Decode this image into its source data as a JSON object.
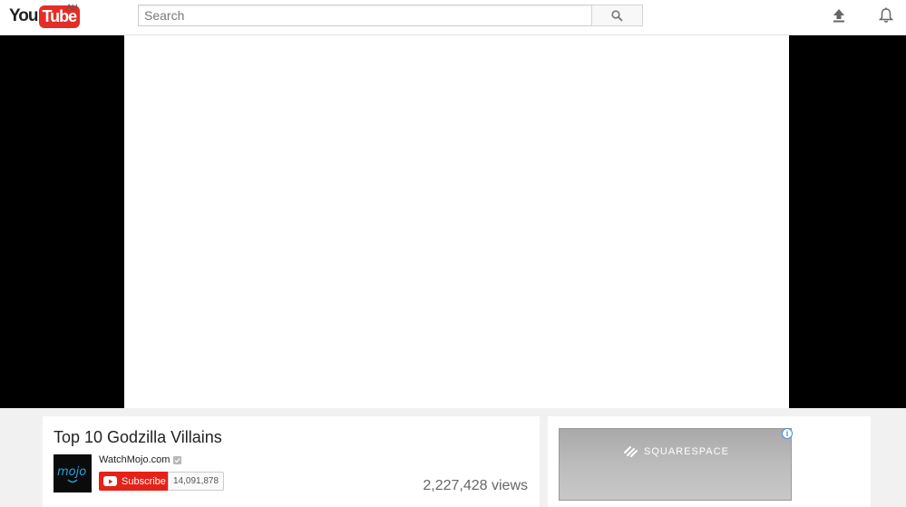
{
  "masthead": {
    "logo_you": "You",
    "logo_tube": "Tube",
    "region": "AU",
    "search_placeholder": "Search"
  },
  "video": {
    "title": "Top 10 Godzilla Villains",
    "channel_name": "WatchMojo.com",
    "subscribe_label": "Subscribe",
    "subscriber_count": "14,091,878",
    "views": "2,227,428 views"
  },
  "ad": {
    "brand": "SQUARESPACE",
    "info_glyph": "i"
  },
  "colors": {
    "brand_red": "#e52d27",
    "subscribe_red": "#e62117",
    "background": "#f1f1f1"
  }
}
